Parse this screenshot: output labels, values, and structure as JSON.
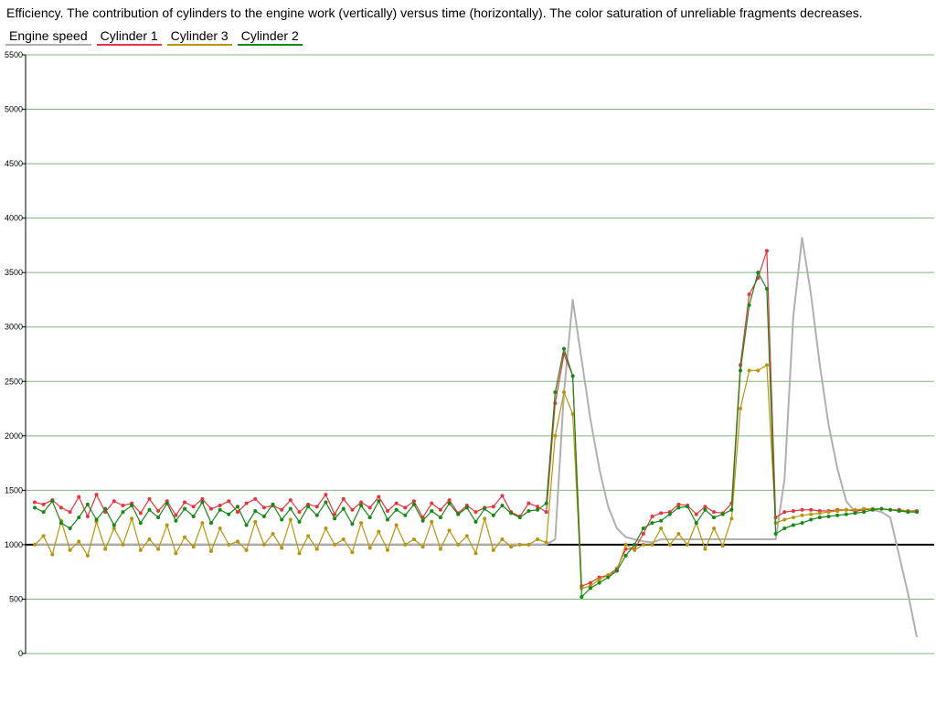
{
  "title": "Efficiency. The contribution of cylinders to the engine work (vertically) versus time (horizontally). The color saturation of unreliable fragments decreases.",
  "legend": [
    {
      "label": "Engine speed",
      "color": "#b0b0b0"
    },
    {
      "label": "Cylinder 1",
      "color": "#e8343c"
    },
    {
      "label": "Cylinder 3",
      "color": "#b8960a"
    },
    {
      "label": "Cylinder 2",
      "color": "#138a13"
    }
  ],
  "chart_data": {
    "type": "line",
    "title": "Efficiency. The contribution of cylinders to the engine work (vertically) versus time (horizontally). The color saturation of unreliable fragments decreases.",
    "xlabel": "",
    "ylabel": "",
    "ylim": [
      0,
      5500
    ],
    "yticks": [
      "0",
      "500",
      "1000",
      "1500",
      "2000",
      "2500",
      "3000",
      "3500",
      "4000",
      "4500",
      "5000",
      "5500"
    ],
    "reference_line": 1000,
    "grid": "horizontal",
    "legend_position": "top-left",
    "x": [
      0,
      1,
      2,
      3,
      4,
      5,
      6,
      7,
      8,
      9,
      10,
      11,
      12,
      13,
      14,
      15,
      16,
      17,
      18,
      19,
      20,
      21,
      22,
      23,
      24,
      25,
      26,
      27,
      28,
      29,
      30,
      31,
      32,
      33,
      34,
      35,
      36,
      37,
      38,
      39,
      40,
      41,
      42,
      43,
      44,
      45,
      46,
      47,
      48,
      49,
      50,
      51,
      52,
      53,
      54,
      55,
      56,
      57,
      58,
      59,
      60,
      61,
      62,
      63,
      64,
      65,
      66,
      67,
      68,
      69,
      70,
      71,
      72,
      73,
      74,
      75,
      76,
      77,
      78,
      79,
      80,
      81,
      82,
      83,
      84,
      85,
      86,
      87,
      88,
      89,
      90,
      91,
      92,
      93,
      94,
      95,
      96,
      97,
      98,
      99,
      100
    ],
    "series": [
      {
        "name": "Engine speed",
        "color": "#b0b0b0",
        "values": [
          1000,
          1000,
          1000,
          1000,
          1000,
          1000,
          1000,
          1000,
          1000,
          1000,
          1000,
          1000,
          1000,
          1000,
          1000,
          1000,
          1000,
          1000,
          1000,
          1000,
          1000,
          1000,
          1000,
          1000,
          1000,
          1000,
          1000,
          1000,
          1000,
          1000,
          1000,
          1000,
          1000,
          1000,
          1000,
          1000,
          1000,
          1000,
          1000,
          1000,
          1000,
          1000,
          1000,
          1000,
          1000,
          1000,
          1000,
          1000,
          1000,
          1000,
          1000,
          1000,
          1000,
          1000,
          1000,
          1000,
          1000,
          1000,
          1000,
          1050,
          2400,
          3250,
          2700,
          2150,
          1700,
          1350,
          1150,
          1070,
          1050,
          1030,
          1020,
          1050,
          1050,
          1050,
          1050,
          1050,
          1050,
          1050,
          1050,
          1050,
          1050,
          1050,
          1050,
          1050,
          1050,
          1600,
          3100,
          3820,
          3300,
          2650,
          2100,
          1700,
          1400,
          1300,
          1330,
          1320,
          1300,
          1250,
          900,
          550,
          150
        ]
      },
      {
        "name": "Cylinder 1",
        "color": "#e8343c",
        "values": [
          1390,
          1370,
          1410,
          1340,
          1300,
          1440,
          1260,
          1460,
          1300,
          1400,
          1360,
          1380,
          1290,
          1420,
          1310,
          1400,
          1270,
          1390,
          1350,
          1420,
          1330,
          1360,
          1400,
          1300,
          1380,
          1420,
          1340,
          1360,
          1320,
          1410,
          1300,
          1370,
          1350,
          1460,
          1280,
          1420,
          1320,
          1390,
          1340,
          1440,
          1310,
          1380,
          1340,
          1400,
          1250,
          1380,
          1320,
          1410,
          1290,
          1360,
          1300,
          1340,
          1350,
          1450,
          1300,
          1260,
          1380,
          1350,
          1300,
          2300,
          2750,
          2550,
          620,
          650,
          700,
          720,
          780,
          960,
          960,
          1100,
          1260,
          1290,
          1300,
          1370,
          1360,
          1280,
          1350,
          1300,
          1290,
          1380,
          2650,
          3300,
          3450,
          3700,
          1250,
          1300,
          1310,
          1320,
          1320,
          1310,
          1310,
          1320,
          1320,
          1310,
          1320,
          1330,
          1330,
          1320,
          1320,
          1310,
          1310
        ]
      },
      {
        "name": "Cylinder 3",
        "color": "#b8960a",
        "values": [
          1000,
          1080,
          910,
          1220,
          950,
          1030,
          900,
          1210,
          960,
          1150,
          1000,
          1240,
          950,
          1050,
          960,
          1180,
          920,
          1070,
          980,
          1200,
          940,
          1150,
          1000,
          1030,
          950,
          1210,
          1000,
          1100,
          970,
          1230,
          920,
          1080,
          960,
          1150,
          1000,
          1050,
          930,
          1200,
          970,
          1120,
          950,
          1180,
          1000,
          1050,
          980,
          1210,
          960,
          1130,
          1000,
          1080,
          920,
          1240,
          950,
          1050,
          980,
          1000,
          1000,
          1050,
          1020,
          2000,
          2400,
          2200,
          600,
          620,
          680,
          720,
          760,
          1000,
          950,
          1000,
          1000,
          1150,
          1000,
          1100,
          1000,
          1200,
          960,
          1150,
          990,
          1240,
          2250,
          2600,
          2600,
          2650,
          1200,
          1230,
          1250,
          1270,
          1280,
          1290,
          1300,
          1310,
          1320,
          1320,
          1330,
          1330,
          1330,
          1320,
          1310,
          1310,
          1300
        ]
      },
      {
        "name": "Cylinder 2",
        "color": "#138a13",
        "values": [
          1340,
          1300,
          1400,
          1200,
          1150,
          1250,
          1370,
          1230,
          1330,
          1180,
          1300,
          1360,
          1200,
          1320,
          1250,
          1380,
          1220,
          1330,
          1260,
          1390,
          1200,
          1320,
          1280,
          1350,
          1180,
          1310,
          1260,
          1370,
          1230,
          1330,
          1210,
          1350,
          1270,
          1390,
          1240,
          1330,
          1190,
          1360,
          1250,
          1400,
          1230,
          1320,
          1270,
          1370,
          1220,
          1310,
          1250,
          1380,
          1280,
          1340,
          1210,
          1330,
          1270,
          1360,
          1290,
          1250,
          1310,
          1320,
          1380,
          2400,
          2800,
          2550,
          520,
          600,
          650,
          700,
          760,
          900,
          1000,
          1150,
          1200,
          1220,
          1280,
          1340,
          1350,
          1200,
          1320,
          1250,
          1280,
          1320,
          2600,
          3200,
          3500,
          3350,
          1100,
          1150,
          1180,
          1200,
          1230,
          1250,
          1260,
          1270,
          1280,
          1290,
          1300,
          1320,
          1330,
          1320,
          1310,
          1300,
          1300
        ]
      }
    ]
  }
}
